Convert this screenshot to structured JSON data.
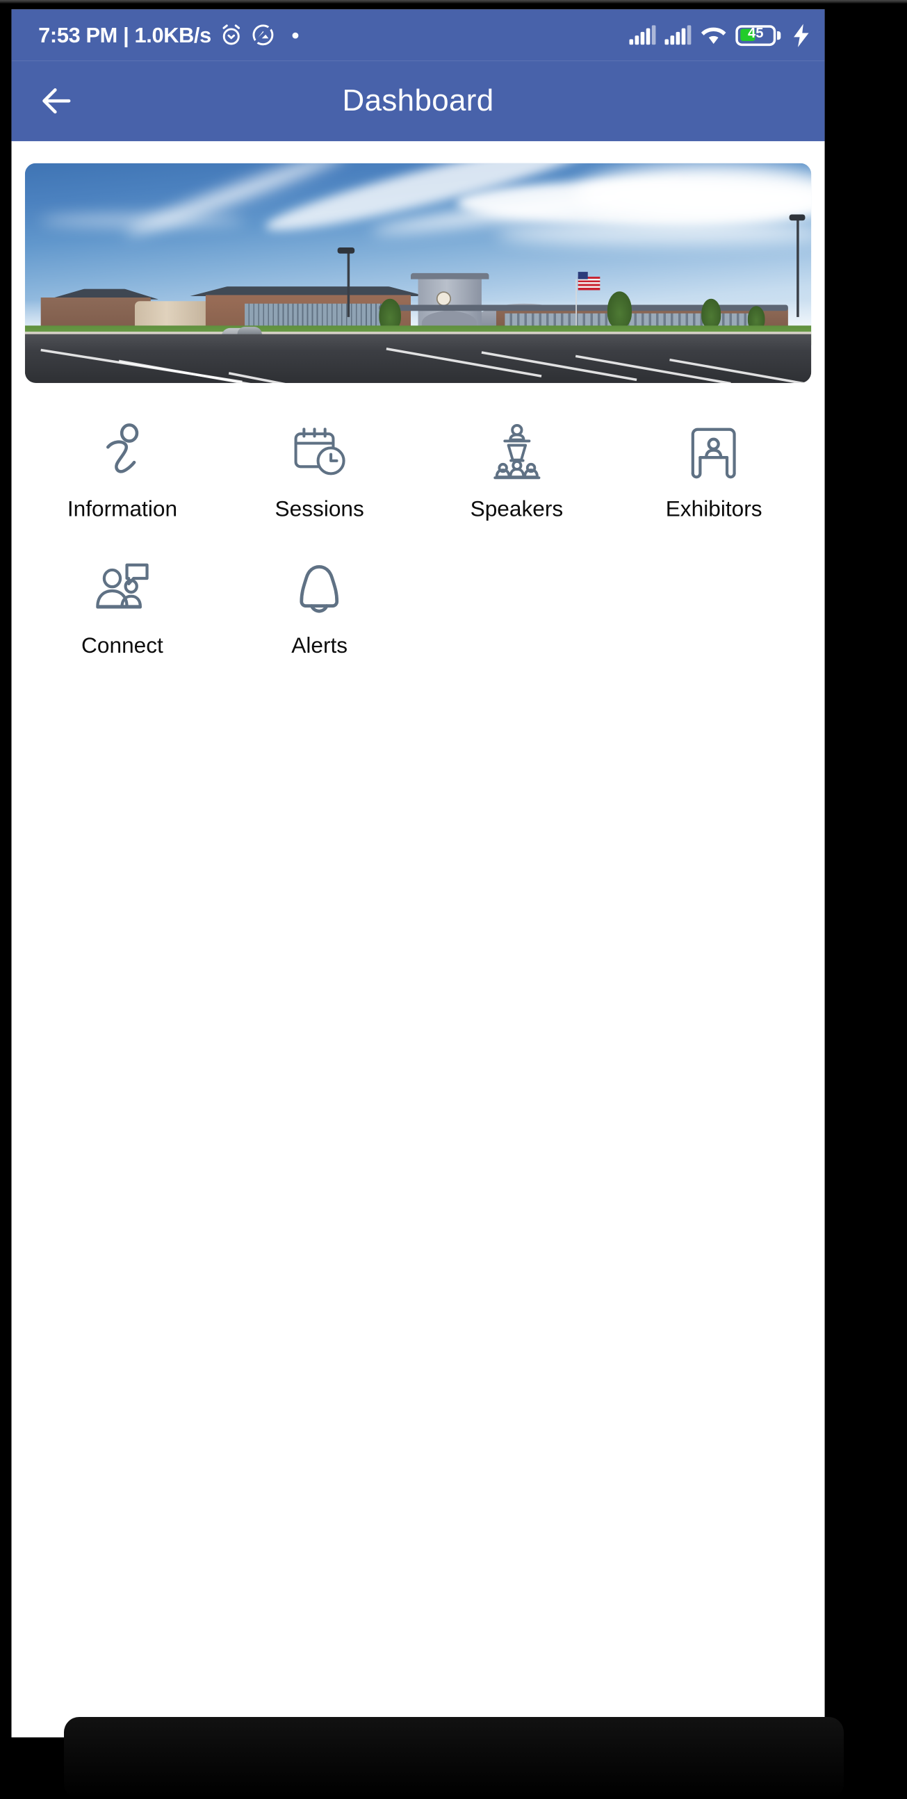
{
  "device": {
    "frame_color": "#000000",
    "earpiece_icon": "speaker-grille-icon",
    "home_indicator_label": "home-indicator"
  },
  "status_bar": {
    "background": "#4862AA",
    "clock_and_network": "7:53 PM | 1.0KB/s",
    "time": "7:53 PM",
    "network_speed": "1.0KB/s",
    "icons": [
      "alarm-clock-icon",
      "do-not-disturb-icon",
      "notification-dot-icon",
      "signal-bars-sim1-icon",
      "signal-bars-sim2-icon",
      "wifi-icon",
      "battery-icon",
      "charging-bolt-icon"
    ],
    "battery_level": "45",
    "battery_fill_color": "#22cc2a",
    "charging": true
  },
  "app_bar": {
    "background": "#4862AA",
    "back_icon": "arrow-left-icon",
    "title": "Dashboard",
    "title_color": "#ffffff"
  },
  "banner": {
    "name": "convention-center-banner",
    "alt": "Convention center building exterior with parking lot, clock tower and American flag under a blue sky",
    "corner_radius": "9px"
  },
  "dashboard": {
    "accent_color": "#4862AA",
    "icon_stroke_color": "#5F7184",
    "label_color": "#0c0c0c",
    "tiles": [
      {
        "label": "Information",
        "icon": "info-italic-icon"
      },
      {
        "label": "Sessions",
        "icon": "calendar-clock-icon"
      },
      {
        "label": "Speakers",
        "icon": "podium-audience-icon"
      },
      {
        "label": "Exhibitors",
        "icon": "exhibition-booth-icon"
      },
      {
        "label": "Connect",
        "icon": "people-chat-icon"
      },
      {
        "label": "Alerts",
        "icon": "bell-icon"
      }
    ]
  }
}
